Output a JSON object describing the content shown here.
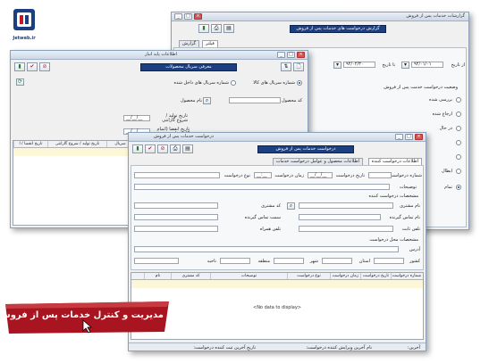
{
  "logo": {
    "text": "Jetweb.ir"
  },
  "banner": {
    "text": "مدیریت و کنترل خدمات پس از فروش"
  },
  "colors": {
    "title_blue": "#1c3f80",
    "banner_red": "#a81420"
  },
  "win_report": {
    "title": "گزارشات خدمات پس از فروش",
    "header": "گزارش درخواست های خدمات پس از فروش",
    "tabs": [
      "فیلتر",
      "گزارش"
    ],
    "date_from_label": "از تاریخ",
    "date_from": "۹۲/۰۱/۰۱",
    "date_to_label": "تا تاریخ",
    "date_to": "۹۲/۰۲/۳۰",
    "status_title": "وضعیت درخواست خدمت پس از فروش",
    "status_items": [
      {
        "label": "بررسی شده",
        "color": "#e9f0f8"
      },
      {
        "label": "ارجاع شده",
        "color": "#f4e8c8"
      },
      {
        "label": "در حال",
        "color": "#c9e9f6"
      },
      {
        "label": "",
        "color": "#cfeecd"
      },
      {
        "label": "",
        "color": "#f6cccc"
      },
      {
        "label": "ابطال",
        "color": "#e9e9b8"
      },
      {
        "label": "تمام",
        "color": ""
      }
    ]
  },
  "win_info": {
    "title": "اطلاعات پایه انبار",
    "header": "معرفی سریال محصولات",
    "radio_serial_goods": "شماره سریال های کالا",
    "radio_serial_inner": "شماره سریال های داخل شده",
    "product_code_label": "کد محصول",
    "product_name_label": "نام محصول",
    "prod_date_label": "تاریخ تولید / شروع گارانتی",
    "prod_date": "__/__/__",
    "expiry_label": "تاریخ انقضا (اتمام گارانتی)",
    "expiry_date": "__/__/__",
    "grid_cols": [
      "سریال",
      "تاریخ تولید / شروع گارانتی",
      "تاریخ انقضا / ا"
    ]
  },
  "win_request": {
    "title": "درخواست خدمات پس از فروش",
    "header": "درخواست خدمات پس از فروش",
    "tabs": [
      "اطلاعات درخواست کننده",
      "اطلاعات محصول و عوامل درخواست خدمات"
    ],
    "req_no_label": "شماره درخواست",
    "req_date_label": "تاریخ درخواست",
    "req_date": "__/__/__",
    "req_time_label": "زمان درخواست",
    "req_time": "__:__",
    "req_type_label": "نوع درخواست",
    "desc_label": "توضیحات",
    "applicant_section": "مشخصات درخواست کننده",
    "customer_name_label": "نام مشتری",
    "customer_code_label": "کد مشتری",
    "contact_name_label": "نام تماس گیرنده",
    "contact_post_label": "سمت تماس گیرنده",
    "phone_label": "تلفن ثابت",
    "mobile_label": "تلفن همراه",
    "location_section": "مشخصات محل درخواست",
    "address_label": "آدرس",
    "country_label": "کشور",
    "province_label": "استان",
    "city_label": "شهر",
    "region_label": "منطقه",
    "district_label": "ناحیه",
    "grid_cols": [
      "شماره درخواست",
      "تاریخ درخواست",
      "زمان درخواست",
      "نوع درخواست",
      "توضیحات",
      "کد مشتری",
      "نام"
    ],
    "no_data": "<No data to display>",
    "footer_left": "تاریخ آخرین ثبت کننده درخواست:",
    "footer_mid": "نام آخرین ویرایش کننده درخواست:",
    "footer_right": "آخرین:"
  }
}
